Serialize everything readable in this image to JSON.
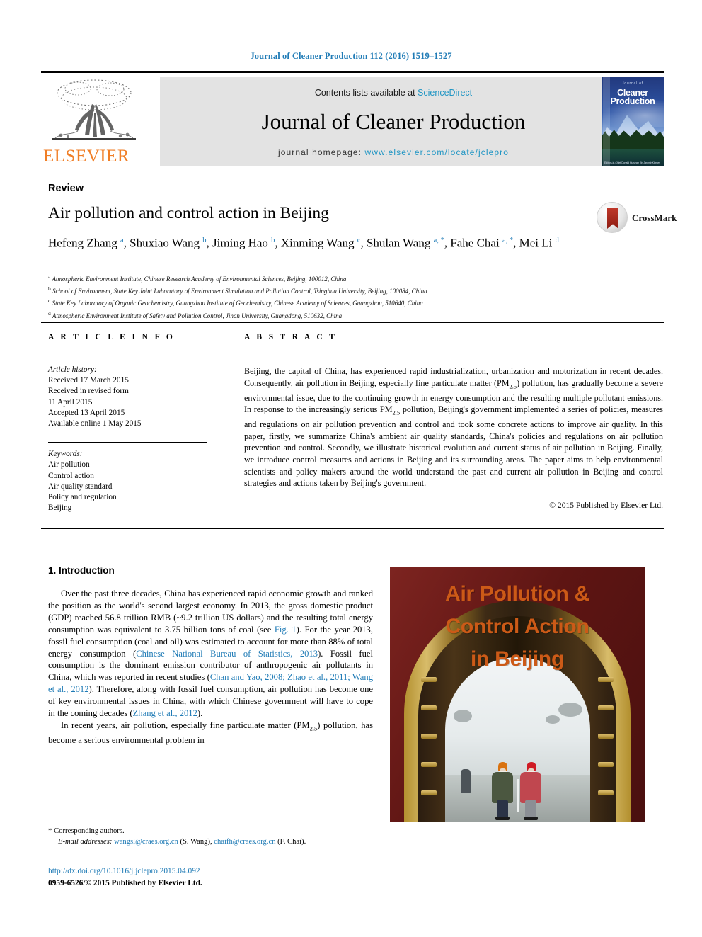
{
  "running_head": "Journal of Cleaner Production 112 (2016) 1519–1527",
  "masthead": {
    "contents_prefix": "Contents lists available at ",
    "sciencedirect": "ScienceDirect",
    "journal_name": "Journal of Cleaner Production",
    "homepage_prefix": "journal homepage: ",
    "homepage_url": "www.elsevier.com/locate/jclepro",
    "publisher_logo_text": "ELSEVIER",
    "cover": {
      "jof": "Journal of",
      "line1": "Cleaner",
      "line2": "Production",
      "footnote": "Editors-in-Chief\nDonald Huisingh\nJiri Jaromir Klemes"
    }
  },
  "article": {
    "type": "Review",
    "title": "Air pollution and control action in Beijing",
    "crossmark_label": "CrossMark",
    "authors_html": "Hefeng Zhang <sup>a</sup>, Shuxiao Wang <sup>b</sup>, Jiming Hao <sup>b</sup>, Xinming Wang <sup>c</sup>, Shulan Wang <sup>a,&nbsp;*</sup>, Fahe Chai <sup>a,&nbsp;*</sup>, Mei Li <sup>d</sup>",
    "affiliations": [
      {
        "marker": "a",
        "text": "Atmospheric Environment Institute, Chinese Research Academy of Environmental Sciences, Beijing, 100012, China"
      },
      {
        "marker": "b",
        "text": "School of Environment, State Key Joint Laboratory of Environment Simulation and Pollution Control, Tsinghua University, Beijing, 100084, China"
      },
      {
        "marker": "c",
        "text": "State Key Laboratory of Organic Geochemistry, Guangzhou Institute of Geochemistry, Chinese Academy of Sciences, Guangzhou, 510640, China"
      },
      {
        "marker": "d",
        "text": "Atmospheric Environment Institute of Safety and Pollution Control, Jinan University, Guangdong, 510632, China"
      }
    ]
  },
  "info": {
    "heading": "A R T I C L E   I N F O",
    "history_label": "Article history:",
    "history": [
      "Received 17 March 2015",
      "Received in revised form",
      "11 April 2015",
      "Accepted 13 April 2015",
      "Available online 1 May 2015"
    ],
    "keywords_label": "Keywords:",
    "keywords": [
      "Air pollution",
      "Control action",
      "Air quality standard",
      "Policy and regulation",
      "Beijing"
    ]
  },
  "abstract": {
    "heading": "A B S T R A C T",
    "body_html": "Beijing, the capital of China, has experienced rapid industrialization, urbanization and motorization in recent decades. Consequently, air pollution in Beijing, especially fine particulate matter (PM<span class=\"sub\">2.5</span>) pollution, has gradually become a severe environmental issue, due to the continuing growth in energy consumption and the resulting multiple pollutant emissions. In response to the increasingly serious PM<span class=\"sub\">2.5</span> pollution, Beijing's government implemented a series of policies, measures and regulations on air pollution prevention and control and took some concrete actions to improve air quality. In this paper, firstly, we summarize China's ambient air quality standards, China's policies and regulations on air pollution prevention and control. Secondly, we illustrate historical evolution and current status of air pollution in Beijing. Finally, we introduce control measures and actions in Beijing and its surrounding areas. The paper aims to help environmental scientists and policy makers around the world understand the past and current air pollution in Beijing and control strategies and actions taken by Beijing's government.",
    "copyright": "© 2015 Published by Elsevier Ltd."
  },
  "body": {
    "section_heading": "1.  Introduction",
    "paragraph_1_html": "Over the past three decades, China has experienced rapid economic growth and ranked the position as the world's second largest economy. In 2013, the gross domestic product (GDP) reached 56.8 trillion RMB (~9.2 trillion US dollars) and the resulting total energy consumption was equivalent to 3.75 billion tons of coal (see <span class=\"ref\">Fig. 1</span>). For the year 2013, fossil fuel consumption (coal and oil) was estimated to account for more than 88% of total energy consumption (<span class=\"ref\">Chinese National Bureau of Statistics, 2013</span>). Fossil fuel consumption is the dominant emission contributor of anthropogenic air pollutants in China, which was reported in recent studies (<span class=\"ref\">Chan and Yao, 2008; Zhao et al., 2011; Wang et al., 2012</span>). Therefore, along with fossil fuel consumption, air pollution has become one of key environmental issues in China, with which Chinese government will have to cope in the coming decades (<span class=\"ref\">Zhang et al., 2012</span>).",
    "paragraph_2_html": "In recent years, air pollution, especially fine particulate matter (PM<span class=\"sub\">2.5</span>) pollution, has become a serious environmental problem in"
  },
  "footnote": {
    "corresponding": "Corresponding authors.",
    "email_label": "E-mail addresses:",
    "email_1": "wangsl@craes.org.cn",
    "email_1_owner": "(S. Wang)",
    "email_2": "chaifh@craes.org.cn",
    "email_2_owner": "(F. Chai)",
    "doi": "http://dx.doi.org/10.1016/j.jclepro.2015.04.092",
    "issn": "0959-6526/© 2015 Published by Elsevier Ltd."
  },
  "graphical_abstract": {
    "line1": "Air Pollution &",
    "line2": "Control Action",
    "line3": "in Beijing",
    "text_color": "#cc5a17"
  },
  "colors": {
    "link_blue": "#1f7bb6",
    "sciencedirect_blue": "#2196c4",
    "elsevier_orange": "#F07E26",
    "band_grey": "#e3e3e3"
  }
}
